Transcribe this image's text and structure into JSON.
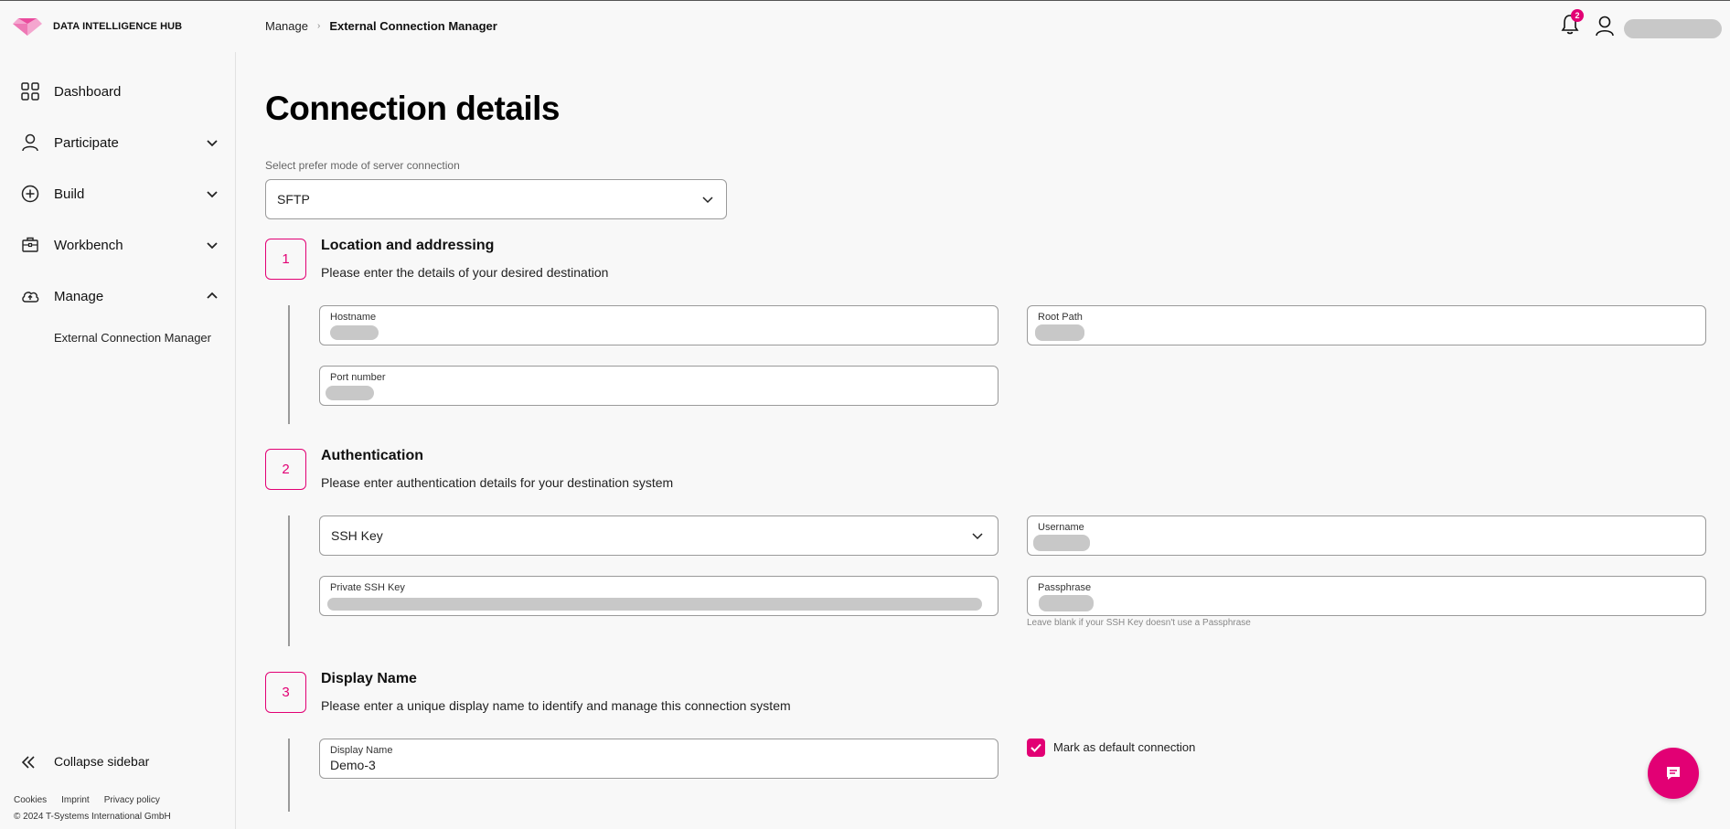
{
  "brand": {
    "name": "DATA INTELLIGENCE HUB",
    "accent": "#e20074"
  },
  "breadcrumb": {
    "parent": "Manage",
    "current": "External Connection Manager"
  },
  "header": {
    "notification_count": "2"
  },
  "sidebar": {
    "items": [
      {
        "label": "Dashboard",
        "icon": "grid-icon"
      },
      {
        "label": "Participate",
        "icon": "person-icon",
        "expanded": false
      },
      {
        "label": "Build",
        "icon": "plus-circle-icon",
        "expanded": false
      },
      {
        "label": "Workbench",
        "icon": "toolbox-icon",
        "expanded": false
      },
      {
        "label": "Manage",
        "icon": "cloud-upload-icon",
        "expanded": true
      }
    ],
    "sub_items": [
      {
        "label": "External Connection Manager"
      }
    ],
    "collapse_label": "Collapse sidebar",
    "footer_links": [
      "Cookies",
      "Imprint",
      "Privacy policy"
    ],
    "copyright": "© 2024 T-Systems International GmbH"
  },
  "main": {
    "title": "Connection details",
    "mode": {
      "label": "Select prefer mode of server connection",
      "value": "SFTP"
    },
    "steps": [
      {
        "number": "1",
        "title": "Location and addressing",
        "description": "Please enter the details of your desired destination",
        "fields": {
          "hostname": "Hostname",
          "root_path": "Root Path",
          "port": "Port number"
        }
      },
      {
        "number": "2",
        "title": "Authentication",
        "description": "Please enter authentication details for your destination system",
        "auth_method": "SSH Key",
        "fields": {
          "username": "Username",
          "private_key": "Private SSH Key",
          "passphrase": "Passphrase"
        },
        "passphrase_helper": "Leave blank if your SSH Key doesn't use a Passphrase"
      },
      {
        "number": "3",
        "title": "Display Name",
        "description": "Please enter a unique display name to identify and manage this connection system",
        "fields": {
          "display_name": "Display Name"
        },
        "display_name_value": "Demo-3",
        "default_checkbox_label": "Mark as default connection",
        "default_checked": true
      }
    ]
  }
}
